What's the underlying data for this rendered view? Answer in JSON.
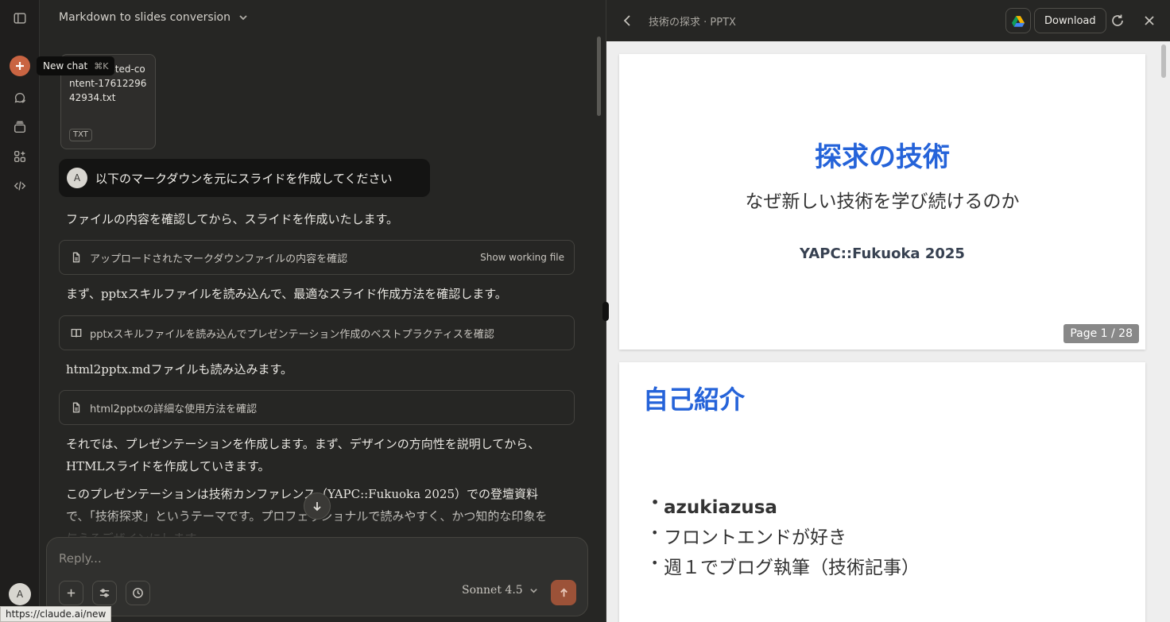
{
  "rail": {
    "tooltip_label": "New chat",
    "tooltip_shortcut": "⌘K",
    "avatar_initial": "A",
    "status_url": "https://claude.ai/new"
  },
  "chat": {
    "title": "Markdown to slides conversion",
    "attachment": {
      "name_visible": "2935_pasted-content-1761229642934.txt",
      "type": "TXT"
    },
    "user_message": {
      "avatar": "A",
      "text": "以下のマークダウンを元にスライドを作成してください"
    },
    "messages": [
      "ファイルの内容を確認してから、スライドを作成いたします。",
      "まず、pptxスキルファイルを読み込んで、最適なスライド作成方法を確認します。",
      "html2pptx.mdファイルも読み込みます。",
      "それでは、プレゼンテーションを作成します。まず、デザインの方向性を説明してから、HTMLスライドを作成していきます。",
      "このプレゼンテーションは技術カンファレンス（YAPC::Fukuoka 2025）での登壇資料で、「技術探求」というテーマです。プロフェッショナルで読みやすく、かつ知的な印象を与えるデザインにします。"
    ],
    "tools": [
      {
        "label": "アップロードされたマークダウンファイルの内容を確認",
        "aside": "Show working file"
      },
      {
        "label": "pptxスキルファイルを読み込んでプレゼンテーション作成のベストプラクティスを確認",
        "aside": ""
      },
      {
        "label": "html2pptxの詳細な使用方法を確認",
        "aside": ""
      }
    ]
  },
  "composer": {
    "placeholder": "Reply...",
    "model": "Sonnet 4.5"
  },
  "panel": {
    "title": "技術の探求 · PPTX",
    "download_label": "Download",
    "slide1": {
      "title": "探求の技術",
      "subtitle": "なぜ新しい技術を学び続けるのか",
      "event": "YAPC::Fukuoka 2025",
      "page_indicator": "Page 1 / 28"
    },
    "slide2": {
      "title": "自己紹介",
      "bullets": [
        "azukiazusa",
        "フロントエンドが好き",
        "週１でブログ執筆（技術記事）"
      ]
    }
  },
  "colors": {
    "accent": "#c96442",
    "slide_title": "#2563d9",
    "send_button": "#9c5238"
  }
}
